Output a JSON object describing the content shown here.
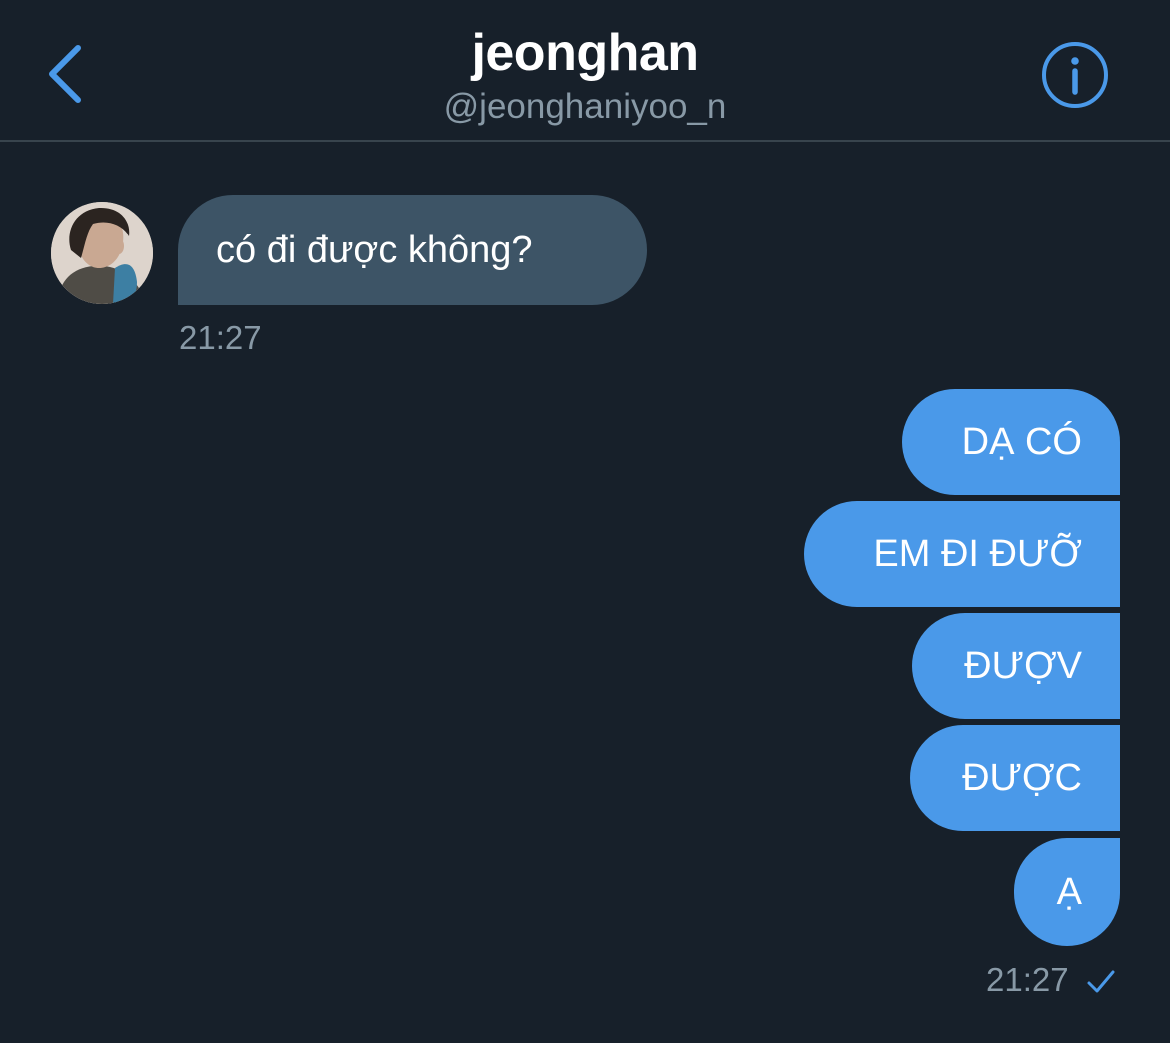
{
  "header": {
    "title": "jeonghan",
    "handle": "@jeonghaniyoo_n"
  },
  "colors": {
    "background": "#17202a",
    "accent": "#4a99e9",
    "incoming_bubble": "#3d5466",
    "muted_text": "#8899a6",
    "divider": "#38444d"
  },
  "icons": {
    "back": "chevron-left-icon",
    "info": "info-icon",
    "read_receipt": "checkmark-icon"
  },
  "messages": {
    "incoming": [
      {
        "text": "có đi được không?"
      }
    ],
    "incoming_time": "21:27",
    "outgoing": [
      {
        "text": "DẠ CÓ"
      },
      {
        "text": "EM ĐI ĐƯỠ"
      },
      {
        "text": "ĐƯỢV"
      },
      {
        "text": "ĐƯỢC"
      },
      {
        "text": "Ạ"
      }
    ],
    "outgoing_time": "21:27"
  }
}
